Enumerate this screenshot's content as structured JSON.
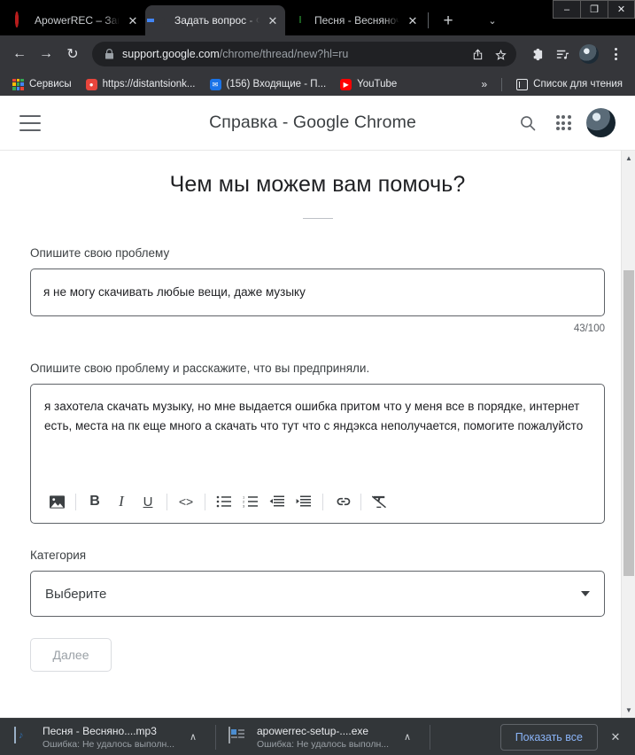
{
  "window": {
    "minimize_label": "–",
    "maximize_label": "❐",
    "close_label": "✕"
  },
  "tabs": [
    {
      "title": "ApowerREC – Запи",
      "favicon": "apowerrec-icon",
      "active": false,
      "close_label": "✕"
    },
    {
      "title": "Задать вопрос - Ф",
      "favicon": "google-icon",
      "active": true,
      "close_label": "✕"
    },
    {
      "title": "Песня - Весняноч",
      "favicon": "music-icon",
      "active": false,
      "close_label": "✕"
    }
  ],
  "tabstrip": {
    "new_tab_label": "+",
    "tab_search_label": "⌄"
  },
  "toolbar": {
    "back_label": "←",
    "forward_label": "→",
    "reload_label": "↻",
    "url_secure": "support.google.com",
    "url_path": "/chrome/thread/new?hl=ru",
    "share_label": "↱",
    "bookmark_label": "☆",
    "extensions_label": "❖",
    "media_label": "♫",
    "menu_label": "⋮"
  },
  "bookmarks": {
    "items": [
      {
        "label": "Сервисы",
        "icon": "apps-grid-icon",
        "color": "#4285f4"
      },
      {
        "label": "https://distantsionk...",
        "icon": "site-icon",
        "color": "#e8453c"
      },
      {
        "label": "(156) Входящие - П...",
        "icon": "mail-icon",
        "color": "#1a73e8"
      },
      {
        "label": "YouTube",
        "icon": "youtube-icon",
        "color": "#ff0000"
      }
    ],
    "overflow_label": "»",
    "reading_list_label": "Список для чтения"
  },
  "page_header": {
    "menu_label": "hamburger-menu",
    "title": "Справка - Google Chrome",
    "search_label": "search-icon",
    "apps_label": "apps-grid-icon",
    "avatar_label": "account-avatar"
  },
  "form": {
    "heading": "Чем мы можем вам помочь?",
    "summary_label": "Опишите свою проблему",
    "summary_value": "я не могу скачивать любые вещи, даже музыку",
    "summary_counter": "43/100",
    "details_label": "Опишите свою проблему и расскажите, что вы предприняли.",
    "details_value": "я захотела скачать музыку, но мне выдается ошибка притом что у меня все в порядке, интернет есть, места на пк еще много а скачать что тут что с яндэкса неполучается, помогите пожалуйсто",
    "category_label": "Категория",
    "category_value": "Выберите",
    "next_label": "Далее"
  },
  "editor_toolbar": [
    {
      "name": "insert-image-icon",
      "label": "image"
    },
    {
      "name": "bold-icon",
      "label": "B"
    },
    {
      "name": "italic-icon",
      "label": "I"
    },
    {
      "name": "underline-icon",
      "label": "U"
    },
    {
      "name": "code-icon",
      "label": "<>"
    },
    {
      "name": "bulleted-list-icon",
      "label": "list"
    },
    {
      "name": "numbered-list-icon",
      "label": "1."
    },
    {
      "name": "outdent-icon",
      "label": "outdent"
    },
    {
      "name": "indent-icon",
      "label": "indent"
    },
    {
      "name": "link-icon",
      "label": "link"
    },
    {
      "name": "clear-formatting-icon",
      "label": "clear"
    }
  ],
  "downloads": [
    {
      "name": "Песня - Весняно....mp3",
      "status": "Ошибка: Не удалось выполн...",
      "icon": "mp3-file-icon",
      "caret": "∧"
    },
    {
      "name": "apowerrec-setup-....exe",
      "status": "Ошибка: Не удалось выполн...",
      "icon": "exe-file-icon",
      "caret": "∧"
    }
  ],
  "downloads_bar": {
    "show_all_label": "Показать все",
    "close_label": "✕"
  },
  "scrollbar": {
    "up_label": "▲",
    "down_label": "▼"
  },
  "colors": {
    "chrome_frame": "#202124",
    "chrome_toolbar": "#35363a",
    "downloads_bar": "#323639",
    "link_blue": "#8ab4f8",
    "page_bg": "#ffffff"
  }
}
